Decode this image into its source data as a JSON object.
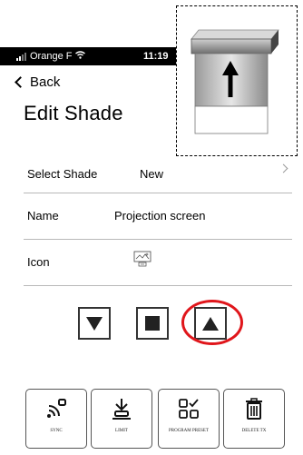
{
  "status_bar": {
    "carrier": "Orange F",
    "time": "11:19"
  },
  "nav": {
    "back_label": "Back"
  },
  "page": {
    "title": "Edit Shade"
  },
  "rows": [
    {
      "label": "Select Shade",
      "value": "New"
    },
    {
      "label": "Name",
      "value": "Projection screen"
    },
    {
      "label": "Icon",
      "value": ""
    }
  ],
  "controls": [
    "down-arrow",
    "stop",
    "up-arrow"
  ],
  "actions": [
    {
      "label": "SYNC",
      "icon": "sync-icon"
    },
    {
      "label": "LIMIT",
      "icon": "limit-icon"
    },
    {
      "label": "PROGRAM PRESET",
      "icon": "program-preset-icon"
    },
    {
      "label": "DELETE TX",
      "icon": "delete-icon"
    }
  ],
  "colors": {
    "highlight": "#e0161b",
    "status_bar": "#000000"
  }
}
